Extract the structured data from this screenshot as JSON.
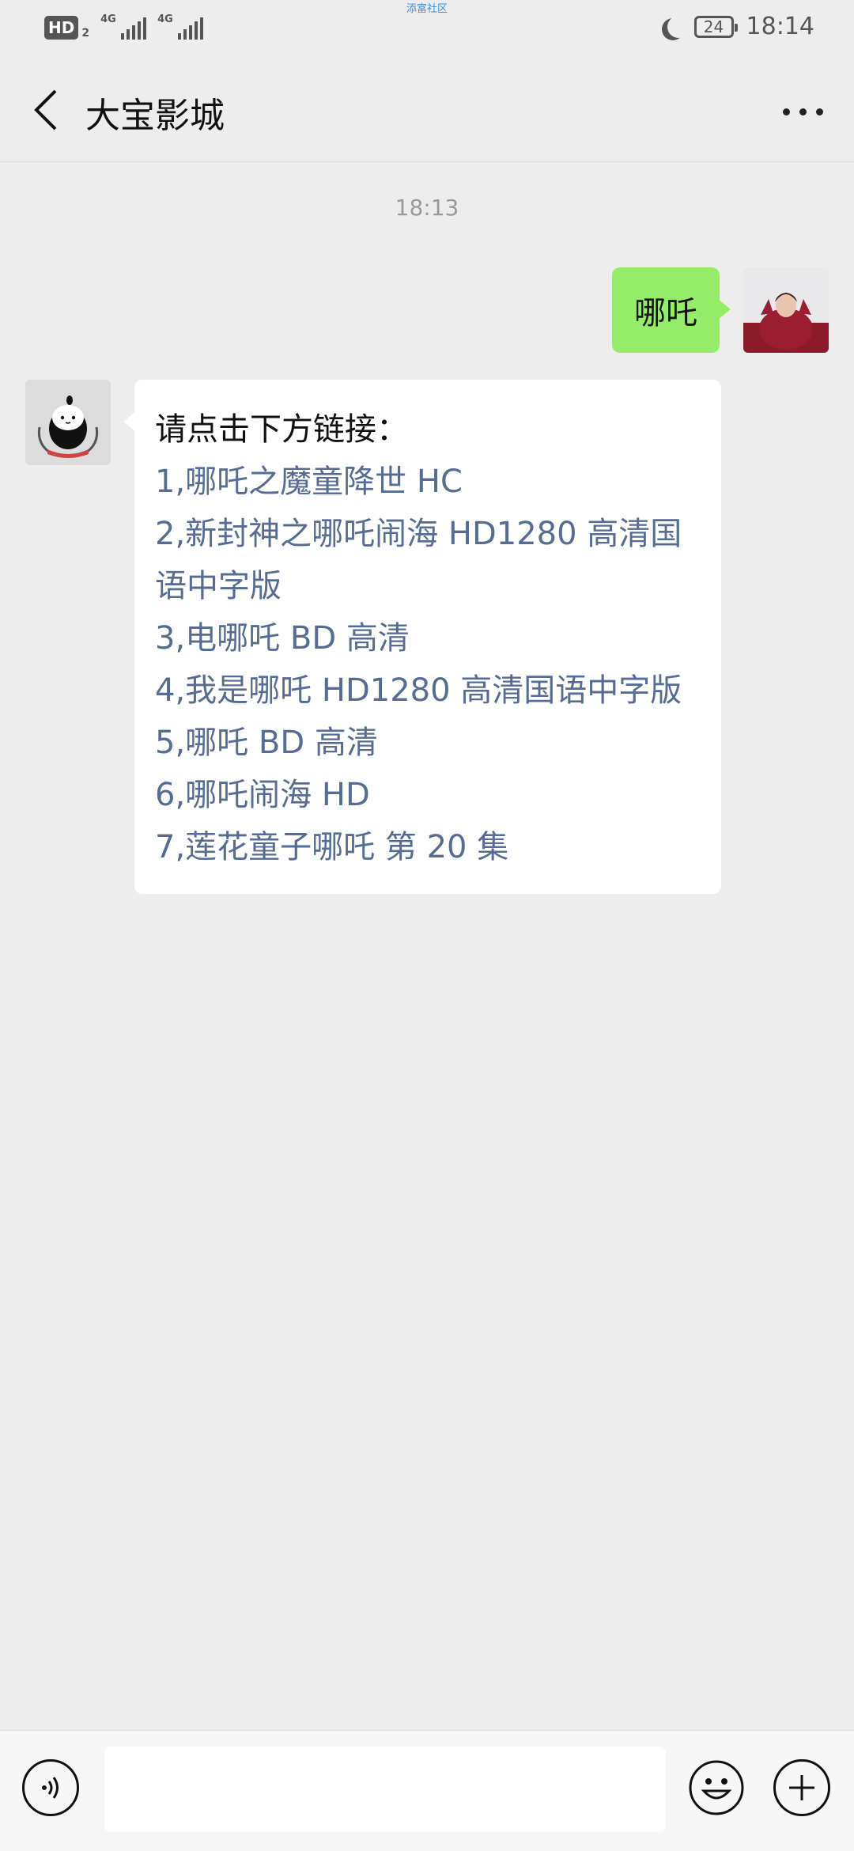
{
  "status_bar": {
    "hd_label": "HD",
    "hd_sub": "2",
    "signal1_label": "4G",
    "signal2_label": "4G",
    "center_text": "添富社区",
    "battery": "24",
    "time": "18:14"
  },
  "header": {
    "title": "大宝影城",
    "back_icon": "chevron-left-icon",
    "more_icon": "more-dots-icon"
  },
  "chat": {
    "timestamp": "18:13",
    "outgoing": {
      "text": "哪吒",
      "avatar": "user-avatar"
    },
    "incoming": {
      "avatar": "bot-avatar",
      "lead": "请点击下方链接：",
      "links": [
        "1,哪吒之魔童降世 HC",
        "2,新封神之哪吒闹海 HD1280 高清国语中字版",
        "3,电哪吒 BD 高清",
        "4,我是哪吒 HD1280 高清国语中字版",
        "5,哪吒 BD 高清",
        "6,哪吒闹海 HD",
        "7,莲花童子哪吒 第 20 集"
      ]
    }
  },
  "input_bar": {
    "voice_icon": "voice-icon",
    "input_value": "",
    "emoji_icon": "emoji-icon",
    "plus_icon": "plus-icon"
  },
  "colors": {
    "background": "#ededed",
    "outgoing_bubble": "#95ec69",
    "link": "#576b95"
  }
}
